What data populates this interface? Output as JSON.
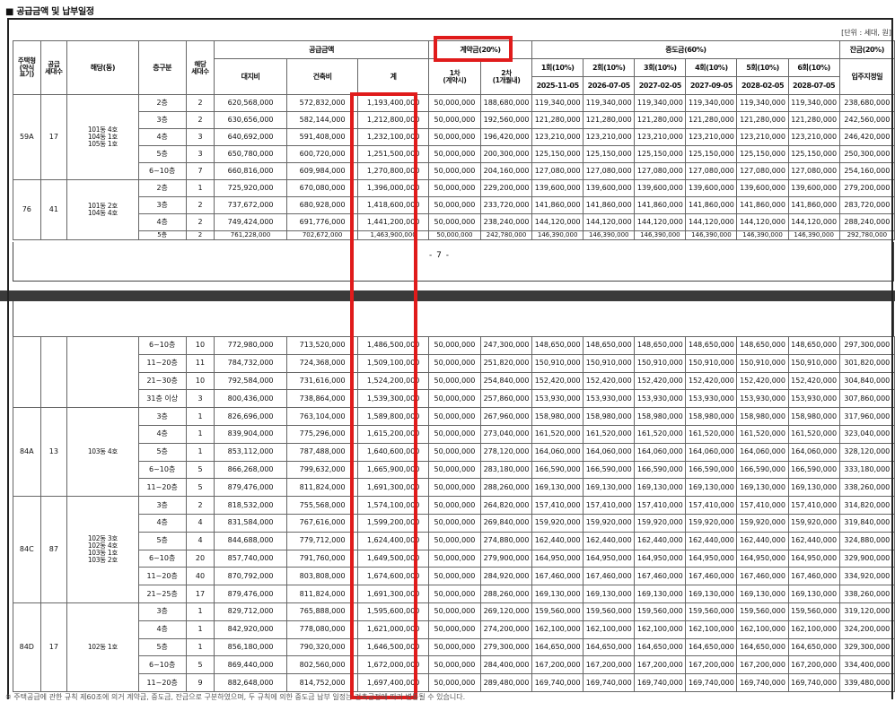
{
  "title": "■ 공급금액 및 납부일정",
  "unit_note": "[단위 : 세대, 원]",
  "page_number": "- 7 -",
  "footnote": "※ 주택공급에 관한 규칙 제60조에 의거 계약금, 중도금, 잔금으로 구분하였으며, 두 규칙에 의한 중도금 납부 일정는 건축공정에 따라 변동될 수 있습니다.",
  "header": {
    "house_type": "주택형\n(약식\n표기)",
    "supply_units": "공급\n세대수",
    "building": "해당(동)",
    "floor_group": "층구분",
    "applicable_units": "해당\n세대수",
    "supply_price": "공급금액",
    "land": "대지비",
    "building_cost": "건축비",
    "total": "계",
    "deposit": "계약금(20%)",
    "deposit_1": "1차\n(계약시)",
    "deposit_2": "2차\n(1개월내)",
    "interim": "중도금(60%)",
    "interim_cols": [
      "1회(10%)",
      "2회(10%)",
      "3회(10%)",
      "4회(10%)",
      "5회(10%)",
      "6회(10%)"
    ],
    "interim_dates": [
      "2025-11-05",
      "2026-07-05",
      "2027-02-05",
      "2027-09-05",
      "2028-02-05",
      "2028-07-05"
    ],
    "balance": "잔금(20%)",
    "balance_sub": "입주지정일"
  },
  "upper_groups": [
    {
      "type": "59A",
      "units": "17",
      "buildings": "101동 4호\n104동 1호\n105동 1호",
      "rows": [
        {
          "floor": "2층",
          "n": "2",
          "land": "620,568,000",
          "build": "572,832,000",
          "total": "1,193,400,000",
          "d1": "50,000,000",
          "d2": "188,680,000",
          "m": [
            "119,340,000",
            "119,340,000",
            "119,340,000",
            "119,340,000",
            "119,340,000",
            "119,340,000"
          ],
          "bal": "238,680,000"
        },
        {
          "floor": "3층",
          "n": "2",
          "land": "630,656,000",
          "build": "582,144,000",
          "total": "1,212,800,000",
          "d1": "50,000,000",
          "d2": "192,560,000",
          "m": [
            "121,280,000",
            "121,280,000",
            "121,280,000",
            "121,280,000",
            "121,280,000",
            "121,280,000"
          ],
          "bal": "242,560,000"
        },
        {
          "floor": "4층",
          "n": "3",
          "land": "640,692,000",
          "build": "591,408,000",
          "total": "1,232,100,000",
          "d1": "50,000,000",
          "d2": "196,420,000",
          "m": [
            "123,210,000",
            "123,210,000",
            "123,210,000",
            "123,210,000",
            "123,210,000",
            "123,210,000"
          ],
          "bal": "246,420,000"
        },
        {
          "floor": "5층",
          "n": "3",
          "land": "650,780,000",
          "build": "600,720,000",
          "total": "1,251,500,000",
          "d1": "50,000,000",
          "d2": "200,300,000",
          "m": [
            "125,150,000",
            "125,150,000",
            "125,150,000",
            "125,150,000",
            "125,150,000",
            "125,150,000"
          ],
          "bal": "250,300,000"
        },
        {
          "floor": "6~10층",
          "n": "7",
          "land": "660,816,000",
          "build": "609,984,000",
          "total": "1,270,800,000",
          "d1": "50,000,000",
          "d2": "204,160,000",
          "m": [
            "127,080,000",
            "127,080,000",
            "127,080,000",
            "127,080,000",
            "127,080,000",
            "127,080,000"
          ],
          "bal": "254,160,000"
        }
      ]
    },
    {
      "type": "76",
      "units": "41",
      "buildings": "101동 2호\n104동 4호",
      "rows": [
        {
          "floor": "2층",
          "n": "1",
          "land": "725,920,000",
          "build": "670,080,000",
          "total": "1,396,000,000",
          "d1": "50,000,000",
          "d2": "229,200,000",
          "m": [
            "139,600,000",
            "139,600,000",
            "139,600,000",
            "139,600,000",
            "139,600,000",
            "139,600,000"
          ],
          "bal": "279,200,000"
        },
        {
          "floor": "3층",
          "n": "2",
          "land": "737,672,000",
          "build": "680,928,000",
          "total": "1,418,600,000",
          "d1": "50,000,000",
          "d2": "233,720,000",
          "m": [
            "141,860,000",
            "141,860,000",
            "141,860,000",
            "141,860,000",
            "141,860,000",
            "141,860,000"
          ],
          "bal": "283,720,000"
        },
        {
          "floor": "4층",
          "n": "2",
          "land": "749,424,000",
          "build": "691,776,000",
          "total": "1,441,200,000",
          "d1": "50,000,000",
          "d2": "238,240,000",
          "m": [
            "144,120,000",
            "144,120,000",
            "144,120,000",
            "144,120,000",
            "144,120,000",
            "144,120,000"
          ],
          "bal": "288,240,000"
        },
        {
          "floor": "5층",
          "n": "2",
          "land": "761,228,000",
          "build": "702,672,000",
          "total": "1,463,900,000",
          "d1": "50,000,000",
          "d2": "242,780,000",
          "m": [
            "146,390,000",
            "146,390,000",
            "146,390,000",
            "146,390,000",
            "146,390,000",
            "146,390,000"
          ],
          "bal": "292,780,000"
        }
      ]
    }
  ],
  "lower_groups": [
    {
      "type": "",
      "units": "",
      "buildings": "",
      "rows": [
        {
          "floor": "6~10층",
          "n": "10",
          "land": "772,980,000",
          "build": "713,520,000",
          "total": "1,486,500,000",
          "d1": "50,000,000",
          "d2": "247,300,000",
          "m": [
            "148,650,000",
            "148,650,000",
            "148,650,000",
            "148,650,000",
            "148,650,000",
            "148,650,000"
          ],
          "bal": "297,300,000"
        },
        {
          "floor": "11~20층",
          "n": "11",
          "land": "784,732,000",
          "build": "724,368,000",
          "total": "1,509,100,000",
          "d1": "50,000,000",
          "d2": "251,820,000",
          "m": [
            "150,910,000",
            "150,910,000",
            "150,910,000",
            "150,910,000",
            "150,910,000",
            "150,910,000"
          ],
          "bal": "301,820,000"
        },
        {
          "floor": "21~30층",
          "n": "10",
          "land": "792,584,000",
          "build": "731,616,000",
          "total": "1,524,200,000",
          "d1": "50,000,000",
          "d2": "254,840,000",
          "m": [
            "152,420,000",
            "152,420,000",
            "152,420,000",
            "152,420,000",
            "152,420,000",
            "152,420,000"
          ],
          "bal": "304,840,000"
        },
        {
          "floor": "31층 이상",
          "n": "3",
          "land": "800,436,000",
          "build": "738,864,000",
          "total": "1,539,300,000",
          "d1": "50,000,000",
          "d2": "257,860,000",
          "m": [
            "153,930,000",
            "153,930,000",
            "153,930,000",
            "153,930,000",
            "153,930,000",
            "153,930,000"
          ],
          "bal": "307,860,000"
        }
      ]
    },
    {
      "type": "84A",
      "units": "13",
      "buildings": "103동 4호",
      "rows": [
        {
          "floor": "3층",
          "n": "1",
          "land": "826,696,000",
          "build": "763,104,000",
          "total": "1,589,800,000",
          "d1": "50,000,000",
          "d2": "267,960,000",
          "m": [
            "158,980,000",
            "158,980,000",
            "158,980,000",
            "158,980,000",
            "158,980,000",
            "158,980,000"
          ],
          "bal": "317,960,000"
        },
        {
          "floor": "4층",
          "n": "1",
          "land": "839,904,000",
          "build": "775,296,000",
          "total": "1,615,200,000",
          "d1": "50,000,000",
          "d2": "273,040,000",
          "m": [
            "161,520,000",
            "161,520,000",
            "161,520,000",
            "161,520,000",
            "161,520,000",
            "161,520,000"
          ],
          "bal": "323,040,000"
        },
        {
          "floor": "5층",
          "n": "1",
          "land": "853,112,000",
          "build": "787,488,000",
          "total": "1,640,600,000",
          "d1": "50,000,000",
          "d2": "278,120,000",
          "m": [
            "164,060,000",
            "164,060,000",
            "164,060,000",
            "164,060,000",
            "164,060,000",
            "164,060,000"
          ],
          "bal": "328,120,000"
        },
        {
          "floor": "6~10층",
          "n": "5",
          "land": "866,268,000",
          "build": "799,632,000",
          "total": "1,665,900,000",
          "d1": "50,000,000",
          "d2": "283,180,000",
          "m": [
            "166,590,000",
            "166,590,000",
            "166,590,000",
            "166,590,000",
            "166,590,000",
            "166,590,000"
          ],
          "bal": "333,180,000"
        },
        {
          "floor": "11~20층",
          "n": "5",
          "land": "879,476,000",
          "build": "811,824,000",
          "total": "1,691,300,000",
          "d1": "50,000,000",
          "d2": "288,260,000",
          "m": [
            "169,130,000",
            "169,130,000",
            "169,130,000",
            "169,130,000",
            "169,130,000",
            "169,130,000"
          ],
          "bal": "338,260,000"
        }
      ]
    },
    {
      "type": "84C",
      "units": "87",
      "buildings": "102동 3호\n102동 4호\n103동 1호\n103동 2호",
      "rows": [
        {
          "floor": "3층",
          "n": "2",
          "land": "818,532,000",
          "build": "755,568,000",
          "total": "1,574,100,000",
          "d1": "50,000,000",
          "d2": "264,820,000",
          "m": [
            "157,410,000",
            "157,410,000",
            "157,410,000",
            "157,410,000",
            "157,410,000",
            "157,410,000"
          ],
          "bal": "314,820,000"
        },
        {
          "floor": "4층",
          "n": "4",
          "land": "831,584,000",
          "build": "767,616,000",
          "total": "1,599,200,000",
          "d1": "50,000,000",
          "d2": "269,840,000",
          "m": [
            "159,920,000",
            "159,920,000",
            "159,920,000",
            "159,920,000",
            "159,920,000",
            "159,920,000"
          ],
          "bal": "319,840,000"
        },
        {
          "floor": "5층",
          "n": "4",
          "land": "844,688,000",
          "build": "779,712,000",
          "total": "1,624,400,000",
          "d1": "50,000,000",
          "d2": "274,880,000",
          "m": [
            "162,440,000",
            "162,440,000",
            "162,440,000",
            "162,440,000",
            "162,440,000",
            "162,440,000"
          ],
          "bal": "324,880,000"
        },
        {
          "floor": "6~10층",
          "n": "20",
          "land": "857,740,000",
          "build": "791,760,000",
          "total": "1,649,500,000",
          "d1": "50,000,000",
          "d2": "279,900,000",
          "m": [
            "164,950,000",
            "164,950,000",
            "164,950,000",
            "164,950,000",
            "164,950,000",
            "164,950,000"
          ],
          "bal": "329,900,000"
        },
        {
          "floor": "11~20층",
          "n": "40",
          "land": "870,792,000",
          "build": "803,808,000",
          "total": "1,674,600,000",
          "d1": "50,000,000",
          "d2": "284,920,000",
          "m": [
            "167,460,000",
            "167,460,000",
            "167,460,000",
            "167,460,000",
            "167,460,000",
            "167,460,000"
          ],
          "bal": "334,920,000"
        },
        {
          "floor": "21~25층",
          "n": "17",
          "land": "879,476,000",
          "build": "811,824,000",
          "total": "1,691,300,000",
          "d1": "50,000,000",
          "d2": "288,260,000",
          "m": [
            "169,130,000",
            "169,130,000",
            "169,130,000",
            "169,130,000",
            "169,130,000",
            "169,130,000"
          ],
          "bal": "338,260,000"
        }
      ]
    },
    {
      "type": "84D",
      "units": "17",
      "buildings": "102동 1호",
      "rows": [
        {
          "floor": "3층",
          "n": "1",
          "land": "829,712,000",
          "build": "765,888,000",
          "total": "1,595,600,000",
          "d1": "50,000,000",
          "d2": "269,120,000",
          "m": [
            "159,560,000",
            "159,560,000",
            "159,560,000",
            "159,560,000",
            "159,560,000",
            "159,560,000"
          ],
          "bal": "319,120,000"
        },
        {
          "floor": "4층",
          "n": "1",
          "land": "842,920,000",
          "build": "778,080,000",
          "total": "1,621,000,000",
          "d1": "50,000,000",
          "d2": "274,200,000",
          "m": [
            "162,100,000",
            "162,100,000",
            "162,100,000",
            "162,100,000",
            "162,100,000",
            "162,100,000"
          ],
          "bal": "324,200,000"
        },
        {
          "floor": "5층",
          "n": "1",
          "land": "856,180,000",
          "build": "790,320,000",
          "total": "1,646,500,000",
          "d1": "50,000,000",
          "d2": "279,300,000",
          "m": [
            "164,650,000",
            "164,650,000",
            "164,650,000",
            "164,650,000",
            "164,650,000",
            "164,650,000"
          ],
          "bal": "329,300,000"
        },
        {
          "floor": "6~10층",
          "n": "5",
          "land": "869,440,000",
          "build": "802,560,000",
          "total": "1,672,000,000",
          "d1": "50,000,000",
          "d2": "284,400,000",
          "m": [
            "167,200,000",
            "167,200,000",
            "167,200,000",
            "167,200,000",
            "167,200,000",
            "167,200,000"
          ],
          "bal": "334,400,000"
        },
        {
          "floor": "11~20층",
          "n": "9",
          "land": "882,648,000",
          "build": "814,752,000",
          "total": "1,697,400,000",
          "d1": "50,000,000",
          "d2": "289,480,000",
          "m": [
            "169,740,000",
            "169,740,000",
            "169,740,000",
            "169,740,000",
            "169,740,000",
            "169,740,000"
          ],
          "bal": "339,480,000"
        }
      ]
    }
  ]
}
